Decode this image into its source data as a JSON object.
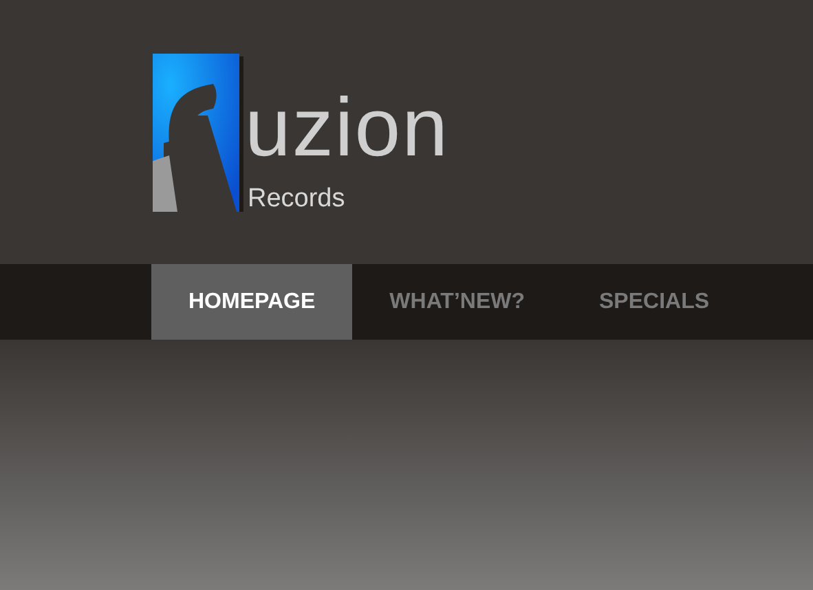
{
  "logo": {
    "wordmark": "uzion",
    "subtitle": "Records"
  },
  "nav": [
    {
      "label": "HOMEPAGE",
      "selected": true
    },
    {
      "label": "WHAT’NEW?",
      "selected": false
    },
    {
      "label": "SPECIALS",
      "selected": false
    }
  ]
}
